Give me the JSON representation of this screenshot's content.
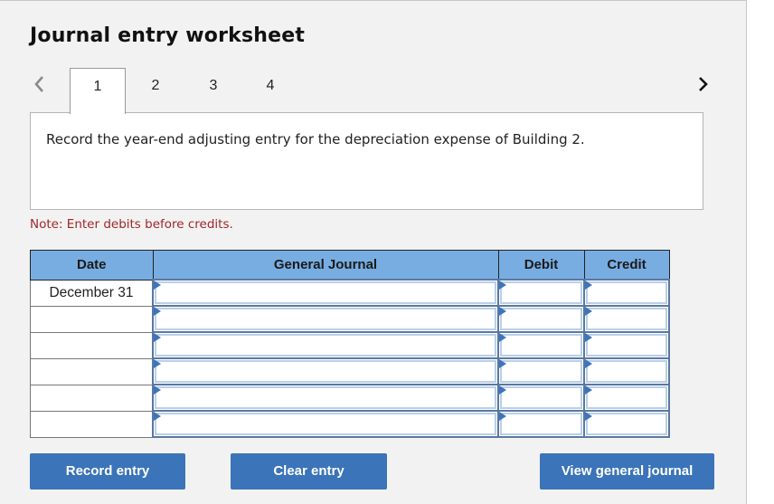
{
  "header": {
    "title": "Journal entry worksheet"
  },
  "nav": {
    "prev_icon": "chevron-left-icon",
    "next_icon": "chevron-right-icon",
    "tabs": [
      {
        "label": "1",
        "active": true
      },
      {
        "label": "2",
        "active": false
      },
      {
        "label": "3",
        "active": false
      },
      {
        "label": "4",
        "active": false
      }
    ]
  },
  "prompt": {
    "text": "Record the year-end adjusting entry for the depreciation expense of Building 2."
  },
  "note": "Note: Enter debits before credits.",
  "journal": {
    "columns": {
      "date": "Date",
      "general_journal": "General Journal",
      "debit": "Debit",
      "credit": "Credit"
    },
    "rows": [
      {
        "date": "December 31",
        "account": "",
        "debit": "",
        "credit": ""
      },
      {
        "date": "",
        "account": "",
        "debit": "",
        "credit": ""
      },
      {
        "date": "",
        "account": "",
        "debit": "",
        "credit": ""
      },
      {
        "date": "",
        "account": "",
        "debit": "",
        "credit": ""
      },
      {
        "date": "",
        "account": "",
        "debit": "",
        "credit": ""
      },
      {
        "date": "",
        "account": "",
        "debit": "",
        "credit": ""
      }
    ]
  },
  "buttons": {
    "record": "Record entry",
    "clear": "Clear entry",
    "view": "View general journal"
  },
  "colors": {
    "header_bg": "#78ade2",
    "button_bg": "#3b74b8",
    "note_text": "#a12727",
    "input_flag": "#3e74ba"
  }
}
